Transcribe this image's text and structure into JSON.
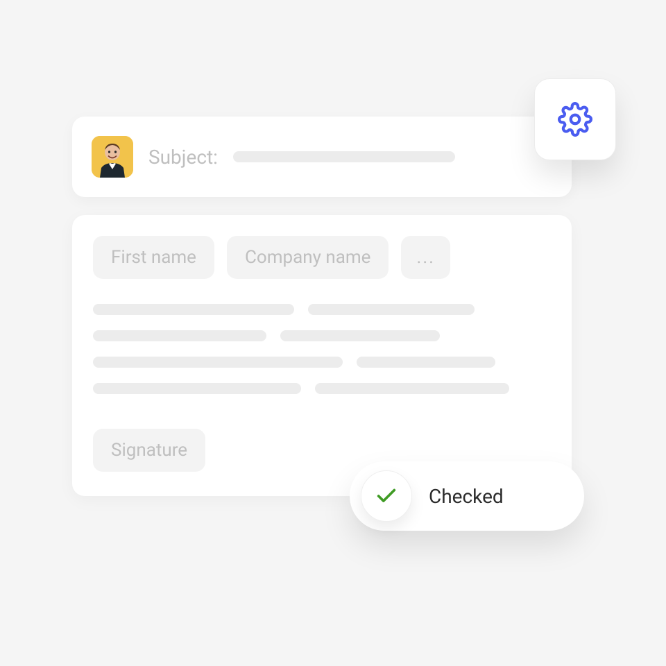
{
  "subject": {
    "label": "Subject:"
  },
  "chips": {
    "first_name": "First name",
    "company_name": "Company name",
    "more": "..."
  },
  "signature": {
    "label": "Signature"
  },
  "checked": {
    "label": "Checked"
  },
  "colors": {
    "accent": "#4a5cf0",
    "success": "#3f9b24",
    "avatar_bg": "#f2c34b"
  }
}
